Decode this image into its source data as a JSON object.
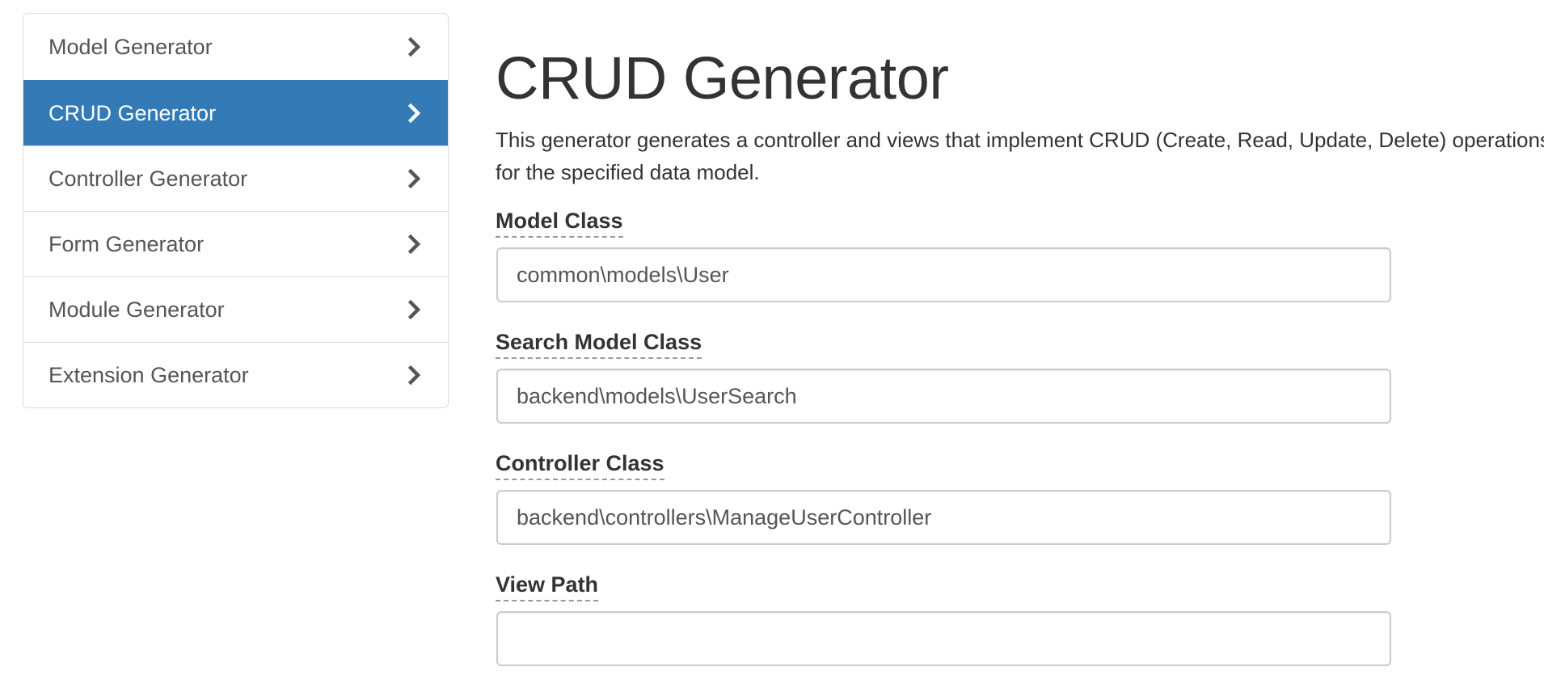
{
  "sidebar": {
    "items": [
      {
        "label": "Model Generator",
        "active": false,
        "icon": "chevron-right-icon"
      },
      {
        "label": "CRUD Generator",
        "active": true,
        "icon": "chevron-right-icon"
      },
      {
        "label": "Controller Generator",
        "active": false,
        "icon": "chevron-right-icon"
      },
      {
        "label": "Form Generator",
        "active": false,
        "icon": "chevron-right-icon"
      },
      {
        "label": "Module Generator",
        "active": false,
        "icon": "chevron-right-icon"
      },
      {
        "label": "Extension Generator",
        "active": false,
        "icon": "chevron-right-icon"
      }
    ]
  },
  "main": {
    "title": "CRUD Generator",
    "description": "This generator generates a controller and views that implement CRUD (Create, Read, Update, Delete) operations for the specified data model.",
    "fields": [
      {
        "label": "Model Class",
        "value": "common\\models\\User",
        "placeholder": ""
      },
      {
        "label": "Search Model Class",
        "value": "backend\\models\\UserSearch",
        "placeholder": ""
      },
      {
        "label": "Controller Class",
        "value": "backend\\controllers\\ManageUserController",
        "placeholder": ""
      },
      {
        "label": "View Path",
        "value": "",
        "placeholder": ""
      }
    ]
  },
  "colors": {
    "accent": "#337ab7",
    "text": "#333333",
    "muted": "#555555",
    "border": "#dddddd"
  }
}
